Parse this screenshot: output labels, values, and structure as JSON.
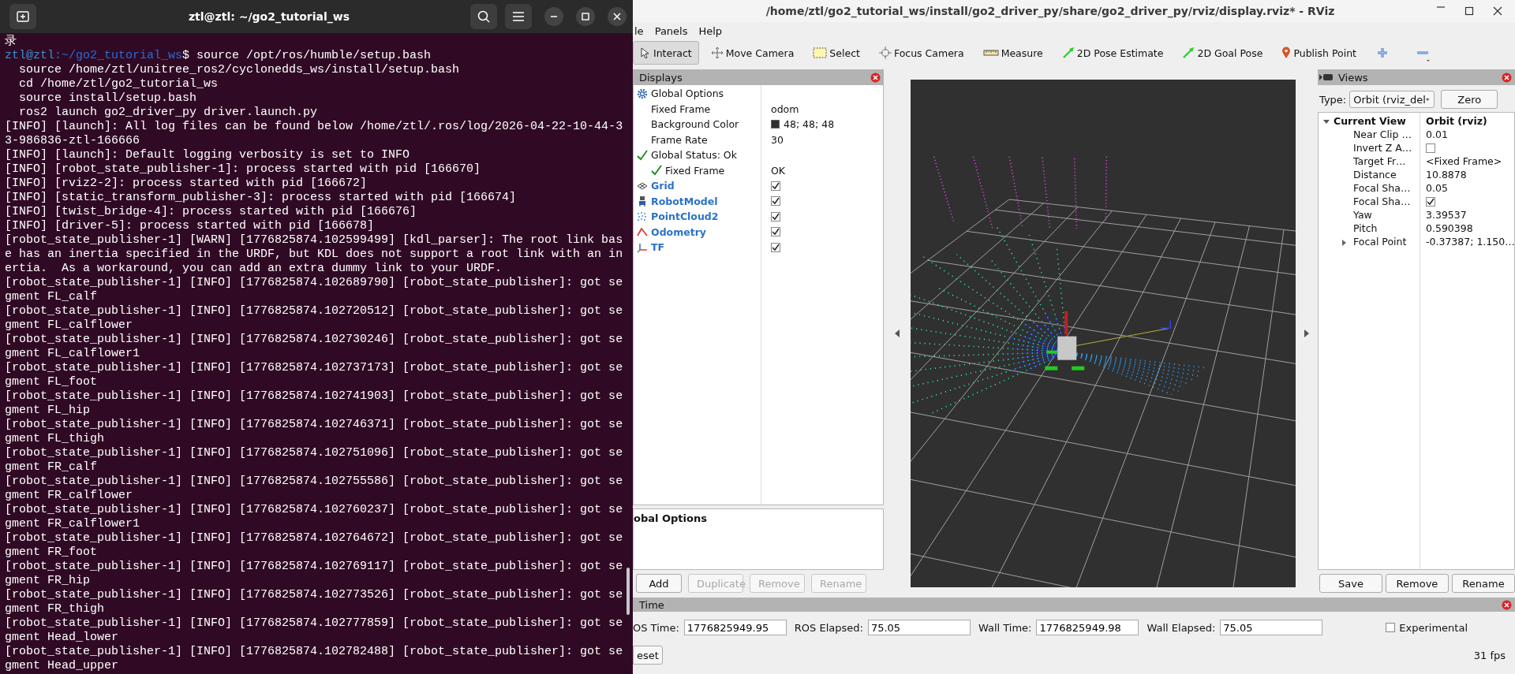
{
  "terminal": {
    "title": "ztl@ztl: ~/go2_tutorial_ws",
    "lines": [
      {
        "kind": "plain",
        "text": "录"
      },
      {
        "kind": "prompt",
        "user": "ztl@ztl",
        "path": ":~/go2_tutorial_ws",
        "text": "$ source /opt/ros/humble/setup.bash"
      },
      {
        "kind": "plain",
        "text": "  source /home/ztl/unitree_ros2/cyclonedds_ws/install/setup.bash"
      },
      {
        "kind": "plain",
        "text": "  cd /home/ztl/go2_tutorial_ws"
      },
      {
        "kind": "plain",
        "text": "  source install/setup.bash"
      },
      {
        "kind": "plain",
        "text": "  ros2 launch go2_driver_py driver.launch.py"
      },
      {
        "kind": "plain",
        "text": "[INFO] [launch]: All log files can be found below /home/ztl/.ros/log/2026-04-22-10-44-3"
      },
      {
        "kind": "plain",
        "text": "3-986836-ztl-166666"
      },
      {
        "kind": "plain",
        "text": "[INFO] [launch]: Default logging verbosity is set to INFO"
      },
      {
        "kind": "plain",
        "text": "[INFO] [robot_state_publisher-1]: process started with pid [166670]"
      },
      {
        "kind": "plain",
        "text": "[INFO] [rviz2-2]: process started with pid [166672]"
      },
      {
        "kind": "plain",
        "text": "[INFO] [static_transform_publisher-3]: process started with pid [166674]"
      },
      {
        "kind": "plain",
        "text": "[INFO] [twist_bridge-4]: process started with pid [166676]"
      },
      {
        "kind": "plain",
        "text": "[INFO] [driver-5]: process started with pid [166678]"
      },
      {
        "kind": "plain",
        "text": "[robot_state_publisher-1] [WARN] [1776825874.102599499] [kdl_parser]: The root link bas"
      },
      {
        "kind": "plain",
        "text": "e has an inertia specified in the URDF, but KDL does not support a root link with an in"
      },
      {
        "kind": "plain",
        "text": "ertia.  As a workaround, you can add an extra dummy link to your URDF."
      },
      {
        "kind": "plain",
        "text": "[robot_state_publisher-1] [INFO] [1776825874.102689790] [robot_state_publisher]: got se"
      },
      {
        "kind": "plain",
        "text": "gment FL_calf"
      },
      {
        "kind": "plain",
        "text": "[robot_state_publisher-1] [INFO] [1776825874.102720512] [robot_state_publisher]: got se"
      },
      {
        "kind": "plain",
        "text": "gment FL_calflower"
      },
      {
        "kind": "plain",
        "text": "[robot_state_publisher-1] [INFO] [1776825874.102730246] [robot_state_publisher]: got se"
      },
      {
        "kind": "plain",
        "text": "gment FL_calflower1"
      },
      {
        "kind": "plain",
        "text": "[robot_state_publisher-1] [INFO] [1776825874.102737173] [robot_state_publisher]: got se"
      },
      {
        "kind": "plain",
        "text": "gment FL_foot"
      },
      {
        "kind": "plain",
        "text": "[robot_state_publisher-1] [INFO] [1776825874.102741903] [robot_state_publisher]: got se"
      },
      {
        "kind": "plain",
        "text": "gment FL_hip"
      },
      {
        "kind": "plain",
        "text": "[robot_state_publisher-1] [INFO] [1776825874.102746371] [robot_state_publisher]: got se"
      },
      {
        "kind": "plain",
        "text": "gment FL_thigh"
      },
      {
        "kind": "plain",
        "text": "[robot_state_publisher-1] [INFO] [1776825874.102751096] [robot_state_publisher]: got se"
      },
      {
        "kind": "plain",
        "text": "gment FR_calf"
      },
      {
        "kind": "plain",
        "text": "[robot_state_publisher-1] [INFO] [1776825874.102755586] [robot_state_publisher]: got se"
      },
      {
        "kind": "plain",
        "text": "gment FR_calflower"
      },
      {
        "kind": "plain",
        "text": "[robot_state_publisher-1] [INFO] [1776825874.102760237] [robot_state_publisher]: got se"
      },
      {
        "kind": "plain",
        "text": "gment FR_calflower1"
      },
      {
        "kind": "plain",
        "text": "[robot_state_publisher-1] [INFO] [1776825874.102764672] [robot_state_publisher]: got se"
      },
      {
        "kind": "plain",
        "text": "gment FR_foot"
      },
      {
        "kind": "plain",
        "text": "[robot_state_publisher-1] [INFO] [1776825874.102769117] [robot_state_publisher]: got se"
      },
      {
        "kind": "plain",
        "text": "gment FR_hip"
      },
      {
        "kind": "plain",
        "text": "[robot_state_publisher-1] [INFO] [1776825874.102773526] [robot_state_publisher]: got se"
      },
      {
        "kind": "plain",
        "text": "gment FR_thigh"
      },
      {
        "kind": "plain",
        "text": "[robot_state_publisher-1] [INFO] [1776825874.102777859] [robot_state_publisher]: got se"
      },
      {
        "kind": "plain",
        "text": "gment Head_lower"
      },
      {
        "kind": "plain",
        "text": "[robot_state_publisher-1] [INFO] [1776825874.102782488] [robot_state_publisher]: got se"
      },
      {
        "kind": "plain",
        "text": "gment Head_upper"
      }
    ]
  },
  "rviz": {
    "title": "/home/ztl/go2_tutorial_ws/install/go2_driver_py/share/go2_driver_py/rviz/display.rviz* - RViz",
    "menu": [
      "le",
      "Panels",
      "Help"
    ],
    "tools": [
      {
        "label": "Interact",
        "selected": true
      },
      {
        "label": "Move Camera",
        "selected": false
      },
      {
        "label": "Select",
        "selected": false
      },
      {
        "label": "Focus Camera",
        "selected": false
      },
      {
        "label": "Measure",
        "selected": false
      },
      {
        "label": "2D Pose Estimate",
        "selected": false
      },
      {
        "label": "2D Goal Pose",
        "selected": false
      },
      {
        "label": "Publish Point",
        "selected": false
      }
    ],
    "displays": {
      "title": "Displays",
      "tree": [
        {
          "kind": "options",
          "label": "Global Options",
          "children": [
            {
              "label": "Fixed Frame",
              "value": "odom"
            },
            {
              "label": "Background Color",
              "value": "48; 48; 48",
              "color": "#303030"
            },
            {
              "label": "Frame Rate",
              "value": "30"
            }
          ]
        },
        {
          "kind": "status",
          "label": "Global Status: Ok",
          "children": [
            {
              "label": "Fixed Frame",
              "value": "OK"
            }
          ]
        },
        {
          "kind": "display",
          "label": "Grid",
          "checked": true
        },
        {
          "kind": "display",
          "label": "RobotModel",
          "checked": true
        },
        {
          "kind": "display",
          "label": "PointCloud2",
          "checked": true
        },
        {
          "kind": "display",
          "label": "Odometry",
          "checked": true
        },
        {
          "kind": "display",
          "label": "TF",
          "checked": true
        }
      ],
      "description": "obal Options",
      "buttons": [
        {
          "label": "Add",
          "disabled": false
        },
        {
          "label": "Duplicate",
          "disabled": true
        },
        {
          "label": "Remove",
          "disabled": true
        },
        {
          "label": "Rename",
          "disabled": true
        }
      ]
    },
    "views": {
      "title": "Views",
      "type_label": "Type:",
      "type_value": "Orbit (rviz_del",
      "zero": "Zero",
      "current": {
        "label": "Current View",
        "value": "Orbit (rviz)",
        "expanded": true
      },
      "props": [
        {
          "kind": "text",
          "label": "Near Clip …",
          "value": "0.01"
        },
        {
          "kind": "check",
          "label": "Invert Z A…",
          "checked": false
        },
        {
          "kind": "text",
          "label": "Target Fr…",
          "value": "<Fixed Frame>"
        },
        {
          "kind": "text",
          "label": "Distance",
          "value": "10.8878"
        },
        {
          "kind": "text",
          "label": "Focal Sha…",
          "value": "0.05"
        },
        {
          "kind": "check",
          "label": "Focal Sha…",
          "checked": true
        },
        {
          "kind": "text",
          "label": "Yaw",
          "value": "3.39537"
        },
        {
          "kind": "text",
          "label": "Pitch",
          "value": "0.590398"
        },
        {
          "kind": "text",
          "label": "Focal Point",
          "value": "-0.37387; 1.150…",
          "expanded": false
        }
      ],
      "buttons": [
        "Save",
        "Remove",
        "Rename"
      ]
    },
    "time": {
      "title": "Time",
      "fields": [
        {
          "label": "OS Time:",
          "value": "1776825949.95"
        },
        {
          "label": "ROS Elapsed:",
          "value": "75.05"
        },
        {
          "label": "Wall Time:",
          "value": "1776825949.98"
        },
        {
          "label": "Wall Elapsed:",
          "value": "75.05"
        }
      ],
      "experimental": {
        "label": "Experimental",
        "checked": false
      },
      "reset": "eset",
      "fps": "31 fps"
    }
  }
}
